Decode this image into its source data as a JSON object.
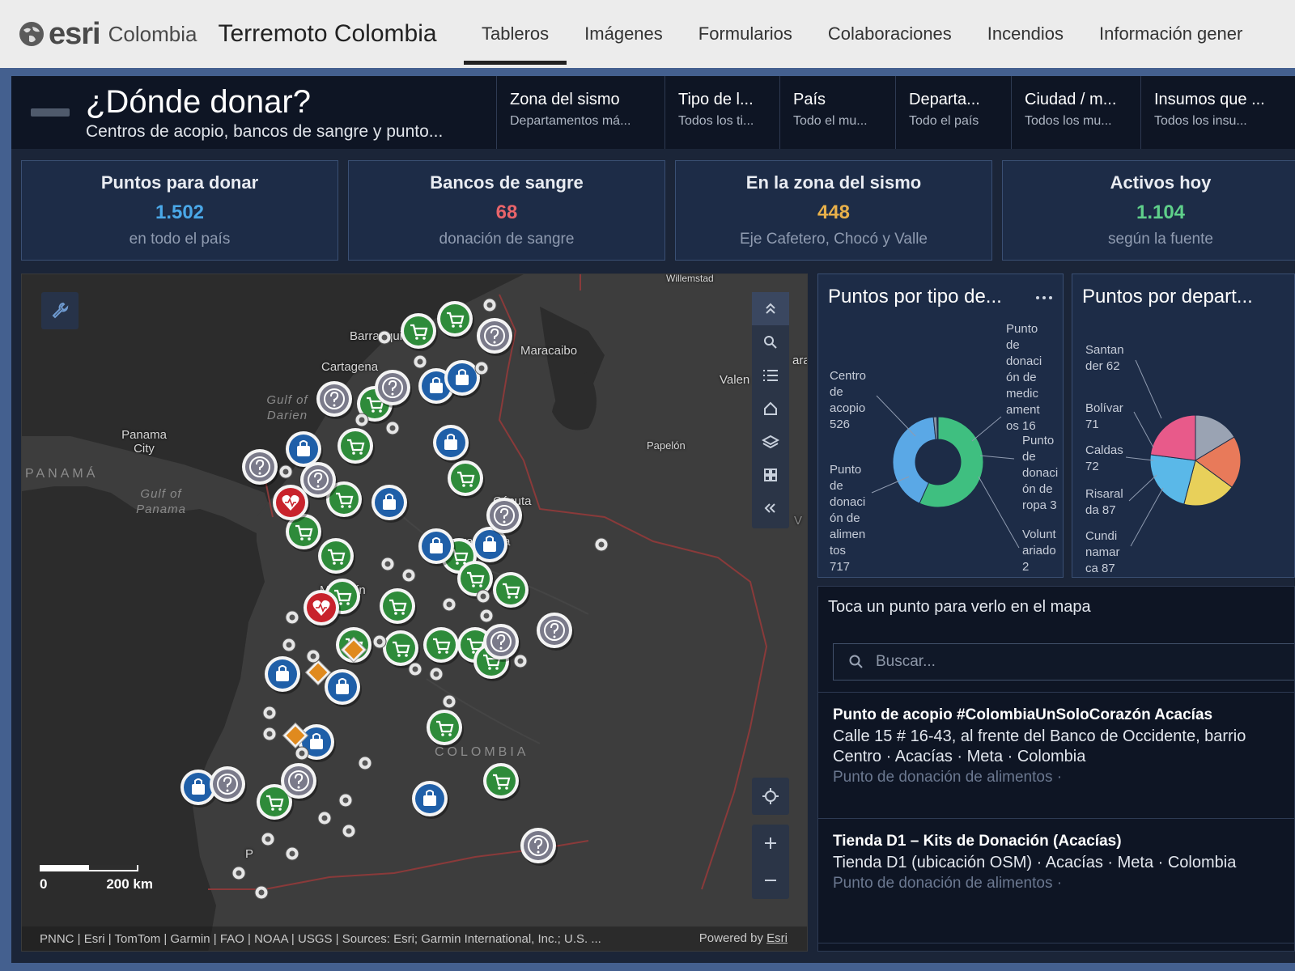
{
  "app": {
    "brand_esri": "esri",
    "brand_country": "Colombia",
    "title": "Terremoto Colombia"
  },
  "nav": {
    "tabs": [
      {
        "label": "Tableros",
        "active": true
      },
      {
        "label": "Imágenes",
        "active": false
      },
      {
        "label": "Formularios",
        "active": false
      },
      {
        "label": "Colaboraciones",
        "active": false
      },
      {
        "label": "Incendios",
        "active": false
      },
      {
        "label": "Información gener",
        "active": false
      }
    ]
  },
  "header": {
    "title": "¿Dónde donar?",
    "subtitle": "Centros de acopio, bancos de sangre y punto..."
  },
  "filters": [
    {
      "label": "Zona del sismo",
      "value": "Departamentos má..."
    },
    {
      "label": "Tipo de l...",
      "value": "Todos los ti..."
    },
    {
      "label": "País",
      "value": "Todo el mu..."
    },
    {
      "label": "Departa...",
      "value": "Todo el país"
    },
    {
      "label": "Ciudad / m...",
      "value": "Todos los mu..."
    },
    {
      "label": "Insumos que ...",
      "value": "Todos los insu..."
    }
  ],
  "kpis": [
    {
      "label": "Puntos para donar",
      "value": "1.502",
      "note": "en todo el país",
      "color": "#4aa8e8"
    },
    {
      "label": "Bancos de sangre",
      "value": "68",
      "note": "donación de sangre",
      "color": "#e8646a"
    },
    {
      "label": "En la zona del sismo",
      "value": "448",
      "note": "Eje Cafetero, Chocó y Valle",
      "color": "#e8b04a"
    },
    {
      "label": "Activos hoy",
      "value": "1.104",
      "note": "según la fuente",
      "color": "#5fd08a"
    }
  ],
  "map": {
    "labels": {
      "barranquilla": "Barranquilla",
      "cartagena": "Cartagena",
      "maracaibo": "Maracaibo",
      "valencia": "Valen",
      "panama_city": "Panama City",
      "panama": "PANAMÁ",
      "gulf_darien": "Gulf of Darien",
      "gulf_panama": "Gulf of Panama",
      "papelon": "Papelón",
      "cucuta": "Cúcuta",
      "bucaramanga": "Bucaramanga",
      "medellin": "Medellín",
      "colombia": "COLOMBIA",
      "willemstad": "Willemstad",
      "aruba": "ara",
      "v": "V",
      "pasto": "P"
    },
    "scale": {
      "zero": "0",
      "distance": "200 km"
    },
    "attribution": "PNNC | Esri | TomTom | Garmin | FAO | NOAA | USGS | Sources: Esri; Garmin International, Inc.; U.S. ...",
    "powered_by": "Powered by",
    "powered_brand": "Esri",
    "colors": {
      "grocery": "#2e8b3a",
      "bag": "#1f5fa8",
      "question": "#7a7a8a",
      "blood": "#c8232c",
      "pill": "#e08a1e"
    }
  },
  "chart_data": [
    {
      "type": "pie",
      "donut": true,
      "title": "Puntos por tipo de...",
      "slices": [
        {
          "name": "Punto de donación de alimentos",
          "value": 717,
          "label_lines": [
            "Punto",
            "de",
            "donaci",
            "ón de",
            "alimen",
            "tos",
            "717"
          ],
          "color": "#3fbf80"
        },
        {
          "name": "Centro de acopio",
          "value": 526,
          "label_lines": [
            "Centro",
            "de",
            "acopio",
            "526"
          ],
          "color": "#5aa8e6"
        },
        {
          "name": "Punto de donación de medicamentos",
          "value": 16,
          "label_lines": [
            "Punto",
            "de",
            "donaci",
            "ón de",
            "medic",
            "ament",
            "os 16"
          ],
          "color": "#8a93a3"
        },
        {
          "name": "Punto de donación de ropa",
          "value": 3,
          "label_lines": [
            "Punto",
            "de",
            "donaci",
            "ón de",
            "ropa 3"
          ],
          "color": "#e8586a"
        },
        {
          "name": "Voluntariado",
          "value": 2,
          "label_lines": [
            "Volunt",
            "ariado",
            "2"
          ],
          "color": "#e0a34a"
        }
      ]
    },
    {
      "type": "pie",
      "donut": false,
      "title": "Puntos por depart...",
      "slices": [
        {
          "name": "Santander",
          "value": 62,
          "label_lines": [
            "Santan",
            "der 62"
          ],
          "color": "#9aa3b3"
        },
        {
          "name": "Bolívar",
          "value": 71,
          "label_lines": [
            "Bolívar",
            "71"
          ],
          "color": "#e87a5a"
        },
        {
          "name": "Caldas",
          "value": 72,
          "label_lines": [
            "Caldas",
            "72"
          ],
          "color": "#e8d05a"
        },
        {
          "name": "Risaralda",
          "value": 87,
          "label_lines": [
            "Risaral",
            "da 87"
          ],
          "color": "#5ab8e8"
        },
        {
          "name": "Cundinamarca",
          "value": 87,
          "label_lines": [
            "Cundi",
            "namar",
            "ca 87"
          ],
          "color": "#e85a8a"
        }
      ]
    }
  ],
  "list": {
    "caption": "Toca un punto para verlo en el mapa",
    "search_placeholder": "Buscar...",
    "items": [
      {
        "title": "Punto de acopio #ColombiaUnSoloCorazón Acacías",
        "desc": "Calle 15 # 16-43, al frente del Banco de Occidente, barrio Centro · Acacías · Meta · Colombia",
        "type": "Punto de donación de alimentos ·"
      },
      {
        "title": "Tienda D1 – Kits de Donación (Acacías)",
        "desc": "Tienda D1 (ubicación OSM) · Acacías · Meta · Colombia",
        "type": "Punto de donación de alimentos ·"
      }
    ]
  }
}
